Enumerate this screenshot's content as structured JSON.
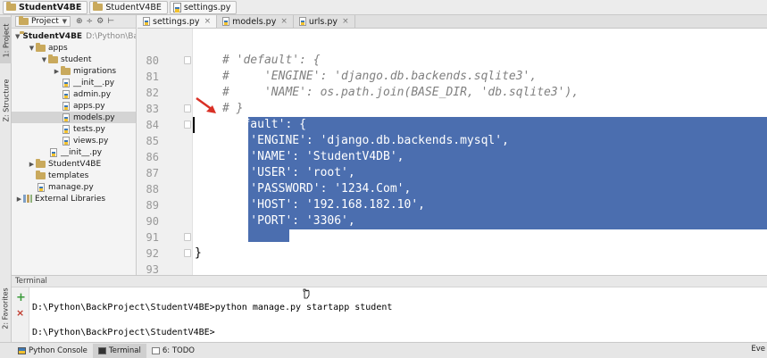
{
  "navbar": {
    "crumbs": [
      "StudentV4BE",
      "StudentV4BE",
      "settings.py"
    ]
  },
  "left_strip": {
    "project_tab": "1: Project",
    "structure_tab": "Z: Structure",
    "favorites_tab": "2: Favorites"
  },
  "project_panel": {
    "dropdown_label": "Project",
    "tree": [
      {
        "label": "StudentV4BE",
        "note": "D:\\Python\\Ba"
      },
      {
        "label": "apps"
      },
      {
        "label": "student"
      },
      {
        "label": "migrations"
      },
      {
        "label": "__init__.py"
      },
      {
        "label": "admin.py"
      },
      {
        "label": "apps.py"
      },
      {
        "label": "models.py"
      },
      {
        "label": "tests.py"
      },
      {
        "label": "views.py"
      },
      {
        "label": "__init__.py"
      },
      {
        "label": "StudentV4BE"
      },
      {
        "label": "templates"
      },
      {
        "label": "manage.py"
      },
      {
        "label": "External Libraries"
      }
    ]
  },
  "editor_tabs": [
    {
      "label": "settings.py",
      "active": true
    },
    {
      "label": "models.py",
      "active": false
    },
    {
      "label": "urls.py",
      "active": false
    }
  ],
  "editor": {
    "lines": [
      {
        "num": "80",
        "text": "# 'default': {"
      },
      {
        "num": "81",
        "text": "#     'ENGINE': 'django.db.backends.sqlite3',"
      },
      {
        "num": "82",
        "text": "#     'NAME': os.path.join(BASE_DIR, 'db.sqlite3'),"
      },
      {
        "num": "83",
        "text": "# }"
      },
      {
        "num": "84",
        "text": "'default': {"
      },
      {
        "num": "85",
        "text": "    'ENGINE': 'django.db.backends.mysql',"
      },
      {
        "num": "86",
        "text": "    'NAME': 'StudentV4DB',"
      },
      {
        "num": "87",
        "text": "    'USER': 'root',"
      },
      {
        "num": "88",
        "text": "    'PASSWORD': '1234.Com',"
      },
      {
        "num": "89",
        "text": "    'HOST': '192.168.182.10',"
      },
      {
        "num": "90",
        "text": "    'PORT': '3306',"
      },
      {
        "num": "91",
        "text": "}"
      },
      {
        "num": "92",
        "text": "}"
      },
      {
        "num": "93",
        "text": ""
      }
    ]
  },
  "terminal": {
    "header": "Terminal",
    "lines": [
      "D:\\Python\\BackProject\\StudentV4BE>python manage.py startapp student",
      "",
      "D:\\Python\\BackProject\\StudentV4BE>"
    ]
  },
  "bottom_bar": {
    "tabs": [
      {
        "label": "Python Console",
        "icon": "python-console-icon"
      },
      {
        "label": "Terminal",
        "icon": "terminal-icon",
        "active": true
      },
      {
        "label": "6: TODO",
        "icon": "todo-icon"
      }
    ],
    "event_log": "Eve"
  },
  "colors": {
    "selection": "#4b6eaf",
    "comment": "#808080",
    "editor_bg": "#ffffff",
    "gutter_bg": "#f0f0f0"
  }
}
